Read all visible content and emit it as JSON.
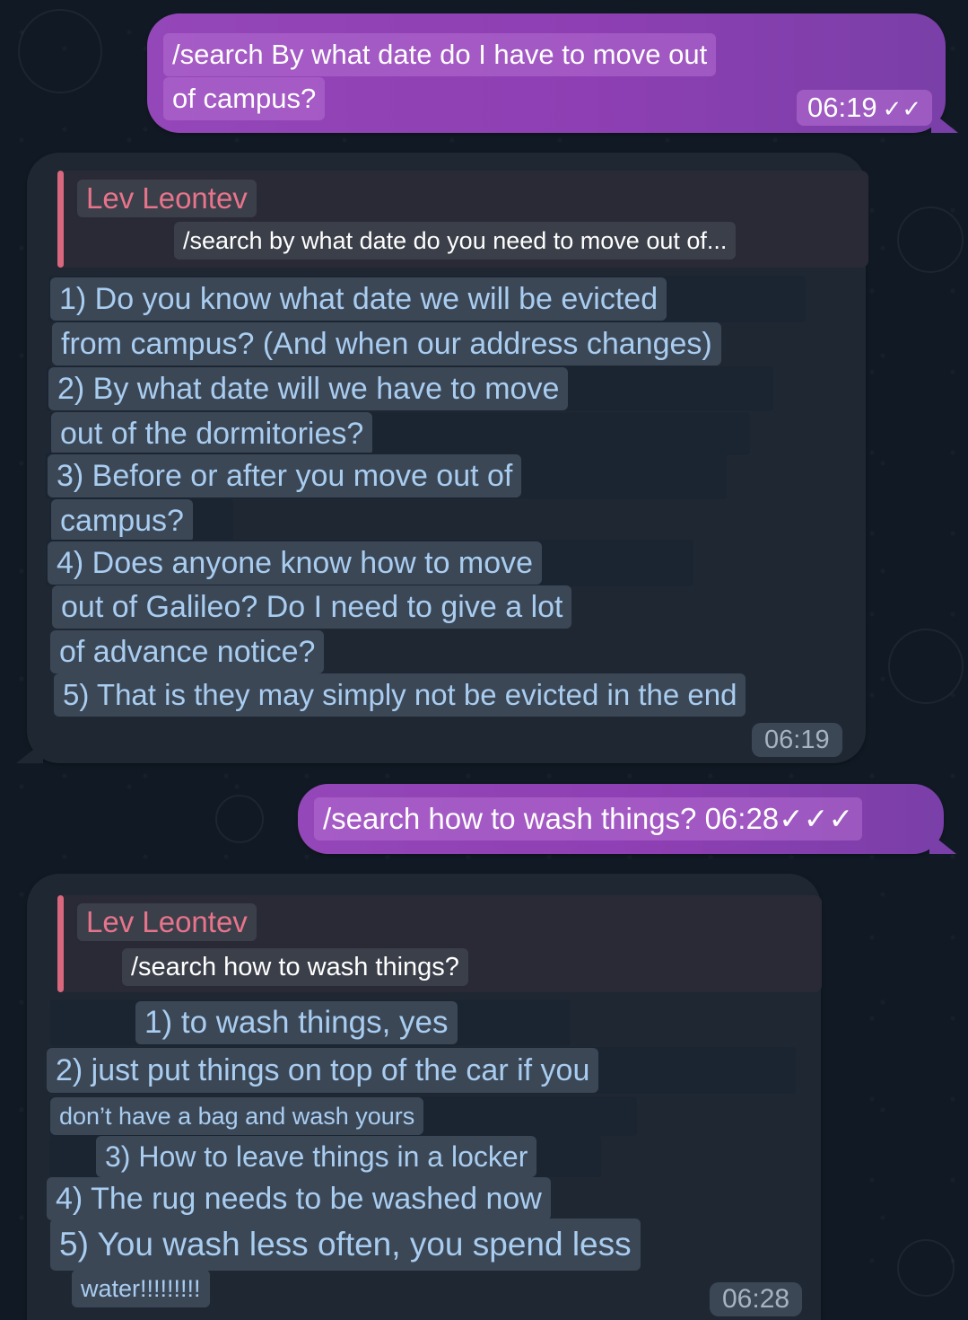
{
  "chat": {
    "messages": [
      {
        "direction": "outgoing",
        "lines": [
          "/search By what date do I have to move out",
          "of campus?"
        ],
        "time": "06:19",
        "status_icon": "double-check-icon"
      },
      {
        "direction": "incoming",
        "reply_to": {
          "sender": "Lev Leontev",
          "text": "/search by what date do you need to move out of..."
        },
        "lines": [
          "1) Do you know what date we will be evicted",
          "from campus? (And when our address changes)",
          "2) By what date will we have to move",
          "out of the dormitories?",
          "3) Before or after you move out of",
          "campus?",
          "4) Does anyone know how to move",
          "out of Galileo? Do I need to give a lot",
          "of advance notice?",
          "5) That is they may simply not be evicted in the end"
        ],
        "time": "06:19"
      },
      {
        "direction": "outgoing",
        "text": "/search how to wash things? 06:28✓✓✓"
      },
      {
        "direction": "incoming",
        "reply_to": {
          "sender": "Lev Leontev",
          "text": "/search how to wash things?"
        },
        "lines": [
          "1) to wash things, yes",
          "2) just put things on top of the car if you",
          "don’t have a bag and wash yours",
          "3) How to leave things in a locker",
          "4) The rug needs to be washed now",
          "5) You wash less often, you spend less",
          "water!!!!!!!!!"
        ],
        "time": "06:28"
      }
    ]
  },
  "colors": {
    "background": "#111a24",
    "outgoing_bubble": "#8e3fb3",
    "incoming_bubble": "#1f2733",
    "sender_name": "#e8748c",
    "incoming_text": "#a9cdf0"
  }
}
